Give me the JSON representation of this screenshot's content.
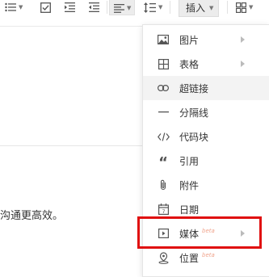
{
  "toolbar": {
    "insert_label": "插入",
    "icons": [
      "unordered-list",
      "checklist",
      "indent",
      "outdent",
      "align",
      "line-height",
      "grid"
    ]
  },
  "editor": {
    "text_fragment": "沟通更高效。"
  },
  "menu": {
    "items": [
      {
        "label": "图片",
        "icon": "image-icon",
        "has_submenu": true,
        "beta": ""
      },
      {
        "label": "表格",
        "icon": "table-icon",
        "has_submenu": true,
        "beta": ""
      },
      {
        "label": "超链接",
        "icon": "link-icon",
        "has_submenu": false,
        "beta": ""
      },
      {
        "label": "分隔线",
        "icon": "divider-icon",
        "has_submenu": false,
        "beta": ""
      },
      {
        "label": "代码块",
        "icon": "code-icon",
        "has_submenu": false,
        "beta": ""
      },
      {
        "label": "引用",
        "icon": "quote-icon",
        "has_submenu": false,
        "beta": ""
      },
      {
        "label": "附件",
        "icon": "attachment-icon",
        "has_submenu": false,
        "beta": ""
      },
      {
        "label": "日期",
        "icon": "calendar-icon",
        "has_submenu": false,
        "beta": ""
      },
      {
        "label": "媒体",
        "icon": "media-icon",
        "has_submenu": true,
        "beta": "beta"
      },
      {
        "label": "位置",
        "icon": "location-icon",
        "has_submenu": false,
        "beta": "beta"
      }
    ]
  },
  "colors": {
    "highlight_border": "#e01010",
    "beta_text": "#f0a48d",
    "hover_bg": "#f3f3f3"
  }
}
